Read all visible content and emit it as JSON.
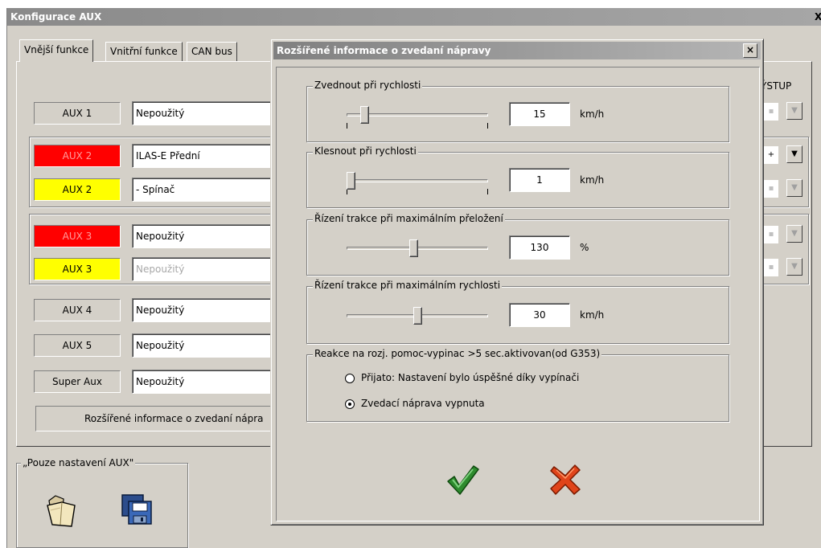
{
  "main": {
    "title": "Konfigurace AUX",
    "close_glyph": "X",
    "tabs": [
      {
        "label": "Vnější funkce",
        "active": true
      },
      {
        "label": "Vnitřní funkce",
        "active": false
      },
      {
        "label": "CAN bus",
        "active": false
      }
    ],
    "output_header": "ÝSTUP",
    "rows": [
      {
        "label": "AUX 1",
        "value": "Nepoužitý",
        "label_color": "#d4d0c8"
      },
      {
        "label": "AUX 2",
        "value": "ILAS-E Přední",
        "label_color": "#ff0000"
      },
      {
        "label": "AUX 2",
        "value": "- Spínač",
        "label_color": "#ffff00"
      },
      {
        "label": "AUX 3",
        "value": "Nepoužitý",
        "label_color": "#ff0000"
      },
      {
        "label": "AUX 3",
        "value": "Nepoužitý",
        "label_color": "#ffff00",
        "disabled": true
      },
      {
        "label": "AUX 4",
        "value": "Nepoužitý",
        "label_color": "#d4d0c8"
      },
      {
        "label": "AUX 5",
        "value": "Nepoužitý",
        "label_color": "#d4d0c8"
      },
      {
        "label": "Super Aux",
        "value": "Nepoužitý",
        "label_color": "#d4d0c8"
      }
    ],
    "extended_info_button": "Rozšířené informace o zvedaní nápra",
    "aux_settings_group": "„Pouze nastavení AUX\"",
    "icons": [
      "folder-open-icon",
      "save-floppy-icon"
    ]
  },
  "dialog": {
    "title": "Rozšířené informace o zvedaní nápravy",
    "close_glyph": "×",
    "sliders": [
      {
        "legend": "Zvednout při rychlosti",
        "value": "15",
        "unit": "km/h",
        "level": 0.1
      },
      {
        "legend": "Klesnout při rychlosti",
        "value": "1",
        "unit": "km/h",
        "level": 0.0
      },
      {
        "legend": "Řízení trakce při maximálním přeložení",
        "value": "130",
        "unit": "%",
        "level": 0.47
      },
      {
        "legend": "Řízení trakce při maximálním rychlosti",
        "value": "30",
        "unit": "km/h",
        "level": 0.5
      }
    ],
    "reaction": {
      "legend": "Reakce na rozj. pomoc-vypinac >5 sec.aktivovan(od G353)",
      "options": [
        {
          "label": "Přijato: Nastavení bylo úspěšné díky vypínači",
          "selected": false
        },
        {
          "label": "Zvedací náprava vypnuta",
          "selected": true
        }
      ]
    },
    "ok_icon": "checkmark-icon",
    "ok_color": "#2e8b2e",
    "cancel_icon": "cross-icon",
    "cancel_color": "#e0441a"
  }
}
